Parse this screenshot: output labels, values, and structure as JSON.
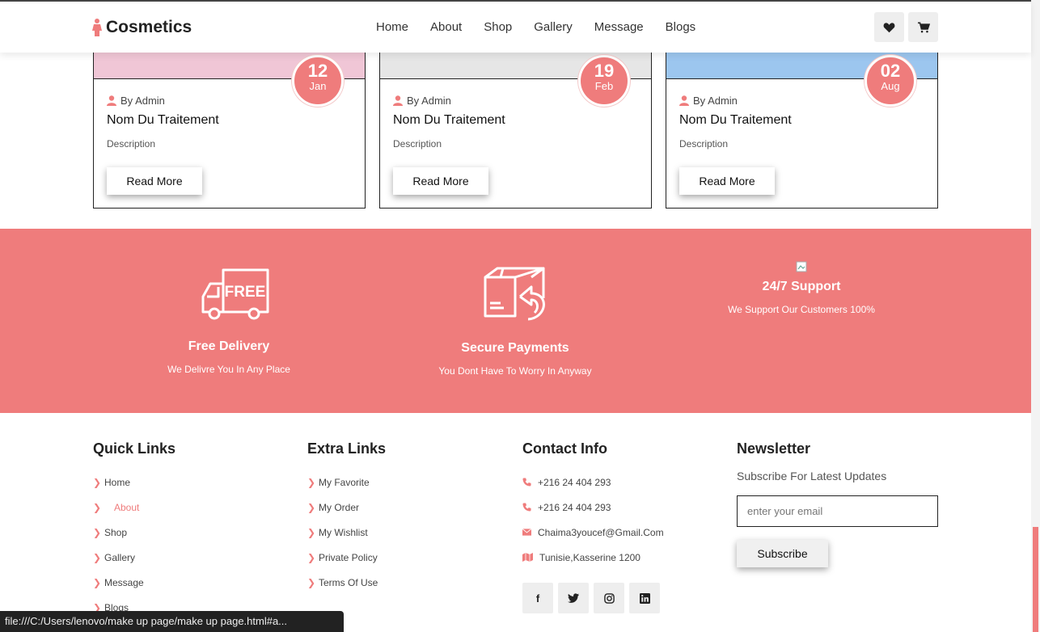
{
  "header": {
    "logo_text": "Cosmetics",
    "nav": [
      "Home",
      "About",
      "Shop",
      "Gallery",
      "Message",
      "Blogs"
    ]
  },
  "blog_cards": [
    {
      "day": "12",
      "month": "Jan",
      "author": "By Admin",
      "title": "Nom Du Traitement",
      "description": "Description",
      "button": "Read More",
      "image_color": "#f0c6d6"
    },
    {
      "day": "19",
      "month": "Feb",
      "author": "By Admin",
      "title": "Nom Du Traitement",
      "description": "Description",
      "button": "Read More",
      "image_color": "#e6e6e6"
    },
    {
      "day": "02",
      "month": "Aug",
      "author": "By Admin",
      "title": "Nom Du Traitement",
      "description": "Description",
      "button": "Read More",
      "image_color": "#9cc6ef"
    }
  ],
  "features": [
    {
      "title": "Free Delivery",
      "desc": "We Delivre You In Any Place",
      "icon": "free-delivery-truck-icon"
    },
    {
      "title": "Secure Payments",
      "desc": "You Dont Have To Worry In Anyway",
      "icon": "return-box-icon"
    },
    {
      "title": "24/7 Support",
      "desc": "We Support Our Customers 100%",
      "icon": "broken-image-icon"
    }
  ],
  "footer": {
    "quick_links_heading": "Quick Links",
    "quick_links": [
      "Home",
      "About",
      "Shop",
      "Gallery",
      "Message",
      "Blogs"
    ],
    "extra_links_heading": "Extra Links",
    "extra_links": [
      "My Favorite",
      "My Order",
      "My Wishlist",
      "Private Policy",
      "Terms Of Use"
    ],
    "contact_heading": "Contact Info",
    "contact": [
      {
        "icon": "phone-icon",
        "text": "+216 24 404 293"
      },
      {
        "icon": "phone-icon",
        "text": "+216 24 404 293"
      },
      {
        "icon": "envelope-icon",
        "text": "Chaima3youcef@Gmail.Com"
      },
      {
        "icon": "map-icon",
        "text": "Tunisie,Kasserine 1200"
      }
    ],
    "social": [
      "facebook-icon",
      "twitter-icon",
      "instagram-icon",
      "linkedin-icon"
    ],
    "newsletter_heading": "Newsletter",
    "newsletter_sub": "Subscribe For Latest Updates",
    "email_placeholder": "enter your email",
    "subscribe_label": "Subscribe"
  },
  "status_url": "file:///C:/Users/lenovo/make up page/make up page.html#a...",
  "colors": {
    "accent": "#ef7c7c"
  }
}
